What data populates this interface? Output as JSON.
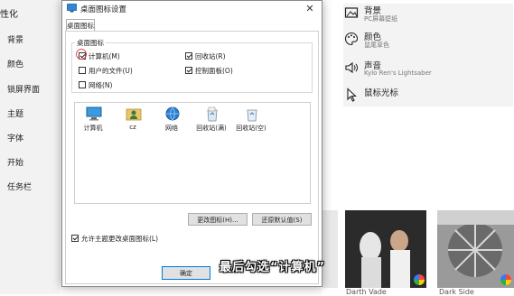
{
  "leftnav": {
    "app_title": "性化",
    "items": [
      "背景",
      "颜色",
      "锁屏界面",
      "主题",
      "字体",
      "开始",
      "任务栏"
    ]
  },
  "rightpanel": {
    "items": [
      {
        "title": "背景",
        "sub": "PC屏幕壁纸",
        "icon": "image-icon"
      },
      {
        "title": "颜色",
        "sub": "鼠尾草色",
        "icon": "palette-icon"
      },
      {
        "title": "声音",
        "sub": "Kylo Ren's Lightsaber",
        "icon": "speaker-icon"
      },
      {
        "title": "鼠标光标",
        "sub": "",
        "icon": "mouse-pointer-icon"
      }
    ],
    "theme_labels": [
      "Darth Vade",
      "Dark Side"
    ]
  },
  "dialog": {
    "title": "桌面图标设置",
    "close_glyph": "✕",
    "tab_label": "桌面图标",
    "group_label": "桌面图标",
    "checkboxes": [
      {
        "label": "计算机(M)",
        "checked": true
      },
      {
        "label": "回收站(R)",
        "checked": true
      },
      {
        "label": "用户的文件(U)",
        "checked": false
      },
      {
        "label": "控制面板(O)",
        "checked": true
      },
      {
        "label": "网络(N)",
        "checked": false
      }
    ],
    "icons": [
      {
        "caption": "计算机",
        "icon": "computer-icon"
      },
      {
        "caption": "cz",
        "icon": "user-folder-icon"
      },
      {
        "caption": "网络",
        "icon": "network-icon"
      },
      {
        "caption": "回收站(满)",
        "icon": "recycle-bin-full-icon"
      },
      {
        "caption": "回收站(空)",
        "icon": "recycle-bin-empty-icon"
      }
    ],
    "change_icon_label": "更改图标(H)...",
    "restore_default_label": "还原默认值(S)",
    "allow_themes_label": "允许主题更改桌面图标(L)",
    "allow_themes_checked": true,
    "ok_label": "确定"
  },
  "subtitle": "最后勾选“计算机”",
  "colors": {
    "accent": "#0078d7",
    "nav_bg": "#f2f2f2",
    "dialog_border": "#8a8a8a"
  }
}
